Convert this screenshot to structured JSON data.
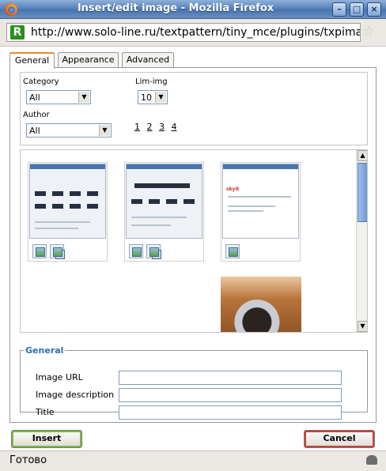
{
  "window": {
    "title": "Insert/edit image - Mozilla Firefox",
    "minimize": "–",
    "maximize": "□",
    "close": "×"
  },
  "urlbar": {
    "badge": "R",
    "url": "http://www.solo-line.ru/textpattern/tiny_mce/plugins/txpimage/i",
    "bookmark_icon": "☆"
  },
  "tabs": [
    {
      "label": "General"
    },
    {
      "label": "Appearance"
    },
    {
      "label": "Advanced"
    }
  ],
  "filters": {
    "category_label": "Category",
    "category_value": "All",
    "lim_label": "Lim-img",
    "lim_value": "10",
    "author_label": "Author",
    "author_value": "All",
    "pages": [
      "1",
      "2",
      "3",
      "4"
    ]
  },
  "gallery": {
    "thumb3_brand": "skyit",
    "scroll_up": "▲",
    "scroll_down": "▼"
  },
  "general": {
    "legend": "General",
    "image_url_label": "Image URL",
    "image_url_value": "",
    "image_description_label": "Image description",
    "image_description_value": "",
    "title_label": "Title",
    "title_value": ""
  },
  "buttons": {
    "insert": "Insert",
    "cancel": "Cancel"
  },
  "status": {
    "text": "Готово"
  },
  "accent": {
    "tab_highlight": "#e68b2c",
    "legend": "#2b6fb6",
    "insert_border": "#7bbb41",
    "cancel_border": "#c8413a"
  }
}
